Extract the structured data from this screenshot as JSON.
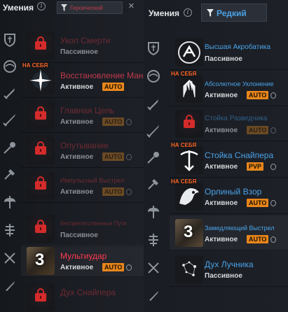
{
  "left": {
    "title": "Умения",
    "filter_label": "Героический",
    "close_label": "×",
    "categories": [
      "shield-dagger-icon",
      "circle-swirl-icon",
      "sword-icon",
      "crossed-swords-icon",
      "flail-icon",
      "pillar-sword-icon",
      "double-axe-icon",
      "axe-stack-icon",
      "crossbow-icon",
      "dagger-icon"
    ],
    "skills": [
      {
        "name": "Укол Смерти",
        "type": "Пассивное",
        "locked": true
      },
      {
        "name": "Восстановление Маны",
        "type": "Активное",
        "badge": "AUTO",
        "equipped": "НА СЕБЯ"
      },
      {
        "name": "Главная Цель",
        "type": "Активное",
        "badge": "AUTO",
        "locked": true
      },
      {
        "name": "Опутывание",
        "type": "Активное",
        "badge": "AUTO",
        "locked": true
      },
      {
        "name": "Импульсный Выстрел",
        "type": "Активное",
        "badge": "AUTO",
        "locked": true
      },
      {
        "name": "Беспрепятственные Пути",
        "type": "Пассивное",
        "locked": true
      },
      {
        "name": "Мультиудар",
        "type": "Активное",
        "badge": "AUTO",
        "icon_text": "3"
      },
      {
        "name": "Дух Снайпера",
        "type": "",
        "locked": true
      }
    ]
  },
  "right": {
    "title": "Умения",
    "filter_label": "Редкий",
    "categories": [
      "shield-dagger-icon",
      "circle-swirl-icon",
      "sword-icon",
      "crossed-swords-icon",
      "flail-icon",
      "pillar-sword-icon",
      "double-axe-icon",
      "axe-stack-icon",
      "crossbow-icon",
      "dagger-icon"
    ],
    "skills": [
      {
        "name": "Высшая Акробатика",
        "type": "Пассивное"
      },
      {
        "name": "Абсолютное Уклонение",
        "type": "Активное",
        "badge": "AUTO",
        "equipped": "НА СЕБЯ"
      },
      {
        "name": "Стойка Разведчика",
        "type": "Активное",
        "badge": "AUTO",
        "locked": true
      },
      {
        "name": "Стойка Снайпера",
        "type": "Активное",
        "badge": "PVP",
        "equipped": "НА СЕБЯ"
      },
      {
        "name": "Орлиный Взор",
        "type": "Активное",
        "badge": "AUTO",
        "equipped": "НА СЕБЯ"
      },
      {
        "name": "Замедляющий Выстрел",
        "type": "Активное",
        "badge": "AUTO",
        "icon_text": "3"
      },
      {
        "name": "Дух Лучника",
        "type": "Пассивное"
      }
    ]
  },
  "colors": {
    "heroic": "#c23a4c",
    "rare": "#4aa2e6",
    "badge": "#e8861b",
    "equipped_label": "#ff6a2a"
  }
}
